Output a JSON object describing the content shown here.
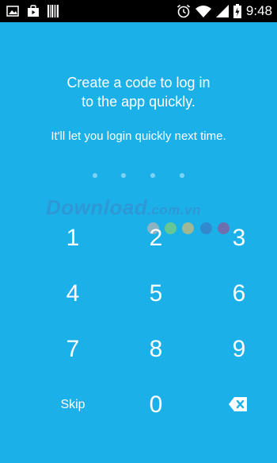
{
  "status_bar": {
    "left_icons": [
      "image-icon",
      "store-icon",
      "barcode-icon"
    ],
    "right_icons": [
      "alarm-icon",
      "wifi-icon",
      "signal-icon",
      "battery-icon"
    ],
    "time": "9:48"
  },
  "prompt": {
    "title_line1": "Create a code to log in",
    "title_line2": "to the app quickly.",
    "subtitle": "It'll let you login quickly next time."
  },
  "pin": {
    "length": 4,
    "entered": 0
  },
  "keypad": {
    "keys": [
      "1",
      "2",
      "3",
      "4",
      "5",
      "6",
      "7",
      "8",
      "9"
    ],
    "skip_label": "Skip",
    "zero": "0",
    "backspace_icon": "backspace-icon"
  },
  "watermark": {
    "text": "Download",
    "domain": ".com.vn",
    "dot_colors": [
      "#b0b4b8",
      "#7fcf7b",
      "#c9b97a",
      "#3a7ec6",
      "#8c5a9a"
    ]
  },
  "colors": {
    "background": "#1cb0e8",
    "status_bar": "#000000",
    "text": "#ffffff",
    "pin_dot": "#7ed3f2"
  }
}
